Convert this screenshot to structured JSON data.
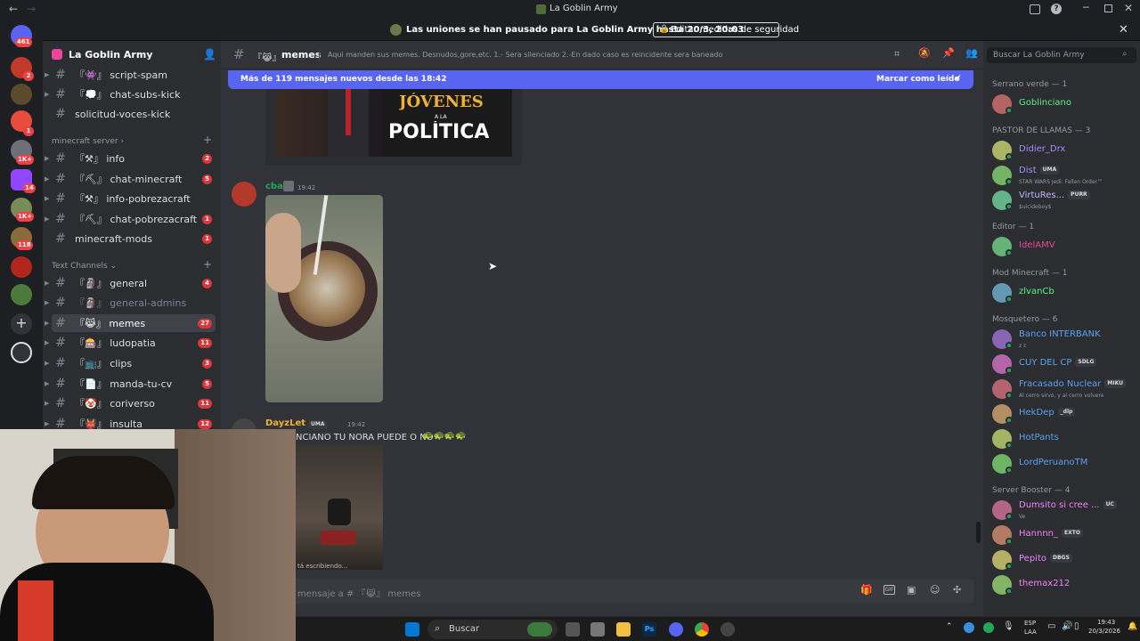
{
  "window": {
    "title": "La Goblin Army",
    "back_icon": "arrow-left-icon",
    "forward_icon": "arrow-right-icon"
  },
  "banner": {
    "text": "Las uniones se han pausado para La Goblin Army hasta 20/3, 20:03",
    "button_label": "Editar medidas de seguridad"
  },
  "guilds": {
    "badges": [
      "461",
      "2",
      "1",
      "1K+",
      "14",
      "1K+",
      "118"
    ]
  },
  "server": {
    "name": "La Goblin Army"
  },
  "categories": {
    "minecraft": "minecraft server",
    "text": "Text Channels"
  },
  "channels": {
    "top": [
      {
        "name": "script-spam",
        "prefix": "『👾』"
      },
      {
        "name": "chat-subs-kick",
        "prefix": "『💭』"
      },
      {
        "name": "solicitud-voces-kick",
        "prefix": ""
      }
    ],
    "minecraft": [
      {
        "name": "info",
        "prefix": "『⚒』",
        "badge": "2"
      },
      {
        "name": "chat-minecraft",
        "prefix": "『⛏』",
        "badge": "5"
      },
      {
        "name": "info-pobrezacraft",
        "prefix": "『⚒』",
        "badge": ""
      },
      {
        "name": "chat-pobrezacraft",
        "prefix": "『⛏』",
        "badge": "1"
      },
      {
        "name": "minecraft-mods",
        "prefix": "",
        "badge": "1"
      }
    ],
    "text": [
      {
        "name": "general",
        "prefix": "『🗿』",
        "badge": "4"
      },
      {
        "name": "general-admins",
        "prefix": "『🗿』",
        "badge": ""
      },
      {
        "name": "memes",
        "prefix": "『😹』",
        "badge": "27"
      },
      {
        "name": "ludopatia",
        "prefix": "『🎰』",
        "badge": "11"
      },
      {
        "name": "clips",
        "prefix": "『📺』",
        "badge": "3"
      },
      {
        "name": "manda-tu-cv",
        "prefix": "『📄』",
        "badge": "5"
      },
      {
        "name": "coriverso",
        "prefix": "『🤡』",
        "badge": "11"
      },
      {
        "name": "insulta",
        "prefix": "『👹』",
        "badge": "12"
      }
    ]
  },
  "header": {
    "channel_name": "memes",
    "channel_prefix": "『😹』",
    "topic": "Aqui manden sus memes. Desnudos,gore,etc. 1.- Sera silenciado 2.-En dado caso es reincidente sera baneado",
    "search_placeholder": "Buscar La Goblin Army"
  },
  "new_messages_bar": {
    "text": "Más de 119 mensajes nuevos desde las 18:42",
    "action": "Marcar como leído"
  },
  "image_text": {
    "line1": "JÓVENES",
    "line2": "A LA",
    "line3": "POLÍTICA"
  },
  "messages": [
    {
      "author": "cba",
      "time": "19:42",
      "author_color": "#23a55a"
    },
    {
      "author": "DayzLet",
      "tag": "UMA",
      "time": "19:42",
      "text": "NCIANO TU ÑORA PUEDE O NO",
      "author_color": "#f0b232"
    }
  ],
  "typing": {
    "text": "tá escribiendo..."
  },
  "composer": {
    "placeholder": "mensaje a # 『😹』 memes"
  },
  "members": {
    "groups": [
      {
        "title": "Serrano verde — 1",
        "items": [
          {
            "name": "Goblinciano",
            "color": "#57f287",
            "status": ""
          }
        ]
      },
      {
        "title": "PASTOR DE LLAMAS — 3",
        "items": [
          {
            "name": "Didier_Drx",
            "color": "#a78bfa",
            "status": ""
          },
          {
            "name": "Dist",
            "color": "#a78bfa",
            "tag": "UMA",
            "status": "STAR WARS Jedi: Fallen Order™"
          },
          {
            "name": "VirtuRes...",
            "color": "#c4b5fd",
            "tag": "PURR",
            "status": "$uicideboy$"
          }
        ]
      },
      {
        "title": "Editor — 1",
        "items": [
          {
            "name": "IdelAMV",
            "color": "#eb459e",
            "status": ""
          }
        ]
      },
      {
        "title": "Mod Minecraft — 1",
        "items": [
          {
            "name": "zlvanCb",
            "color": "#57f287",
            "status": ""
          }
        ]
      },
      {
        "title": "Mosquetero — 6",
        "items": [
          {
            "name": "Banco INTERBANK",
            "color": "#5aa2f0",
            "status": "z z"
          },
          {
            "name": "CUY DEL CP",
            "color": "#5aa2f0",
            "tag": "SDLG",
            "status": ""
          },
          {
            "name": "Fracasado Nuclear",
            "color": "#5aa2f0",
            "tag": "MIKU",
            "status": "Al cerro sirvo, y al cerro volvere"
          },
          {
            "name": "HekDep",
            "color": "#5aa2f0",
            "tag": "_dlp",
            "status": ""
          },
          {
            "name": "HotPants",
            "color": "#5aa2f0",
            "status": ""
          },
          {
            "name": "LordPeruanoTM",
            "color": "#5aa2f0",
            "status": ""
          }
        ]
      },
      {
        "title": "Server Booster — 4",
        "items": [
          {
            "name": "Dumsito si cree ...",
            "color": "#f47fff",
            "tag": "UC",
            "status": "Ve"
          },
          {
            "name": "Hannnn_",
            "color": "#f47fff",
            "tag": "EXTO",
            "status": ""
          },
          {
            "name": "Pepito",
            "color": "#f47fff",
            "tag": "DBGS",
            "status": ""
          },
          {
            "name": "themax212",
            "color": "#f47fff",
            "status": ""
          }
        ]
      }
    ]
  },
  "taskbar": {
    "search": "Buscar",
    "lang": "ESP",
    "lang2": "LAA",
    "time": "19:43",
    "date": "20/3/2026"
  }
}
